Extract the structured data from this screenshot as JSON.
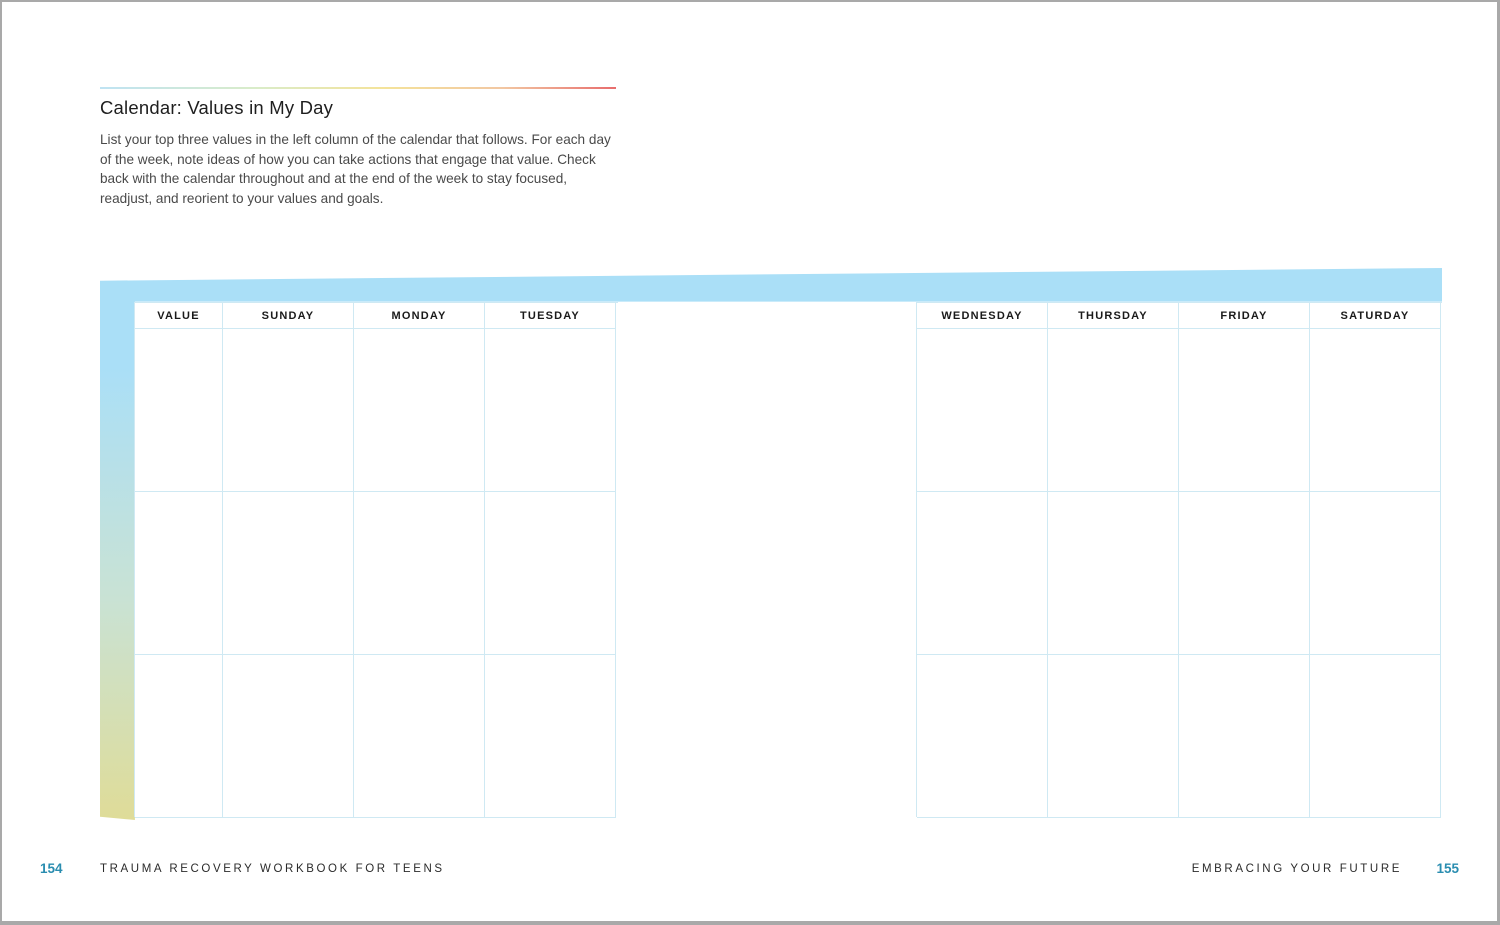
{
  "section": {
    "title": "Calendar: Values in My Day",
    "instructions": "List your top three values in the left column of the calendar that follows. For each day of the week, note ideas of how you can take actions that engage that value. Check back with the calendar throughout and at the end of the week to stay focused, readjust, and reorient to your values and goals."
  },
  "calendar": {
    "left_headers": [
      "VALUE",
      "SUNDAY",
      "MONDAY",
      "TUESDAY"
    ],
    "right_headers": [
      "WEDNESDAY",
      "THURSDAY",
      "FRIDAY",
      "SATURDAY"
    ],
    "value_rows": 3
  },
  "footer": {
    "left_page_number": "154",
    "left_running_head": "TRAUMA RECOVERY WORKBOOK FOR TEENS",
    "right_running_head": "EMBRACING YOUR FUTURE",
    "right_page_number": "155"
  },
  "colors": {
    "band_top": "#aadff7",
    "band_bottom": "#dfdc98",
    "page_number": "#2a8db0",
    "grid_line": "#cfe9f3"
  }
}
